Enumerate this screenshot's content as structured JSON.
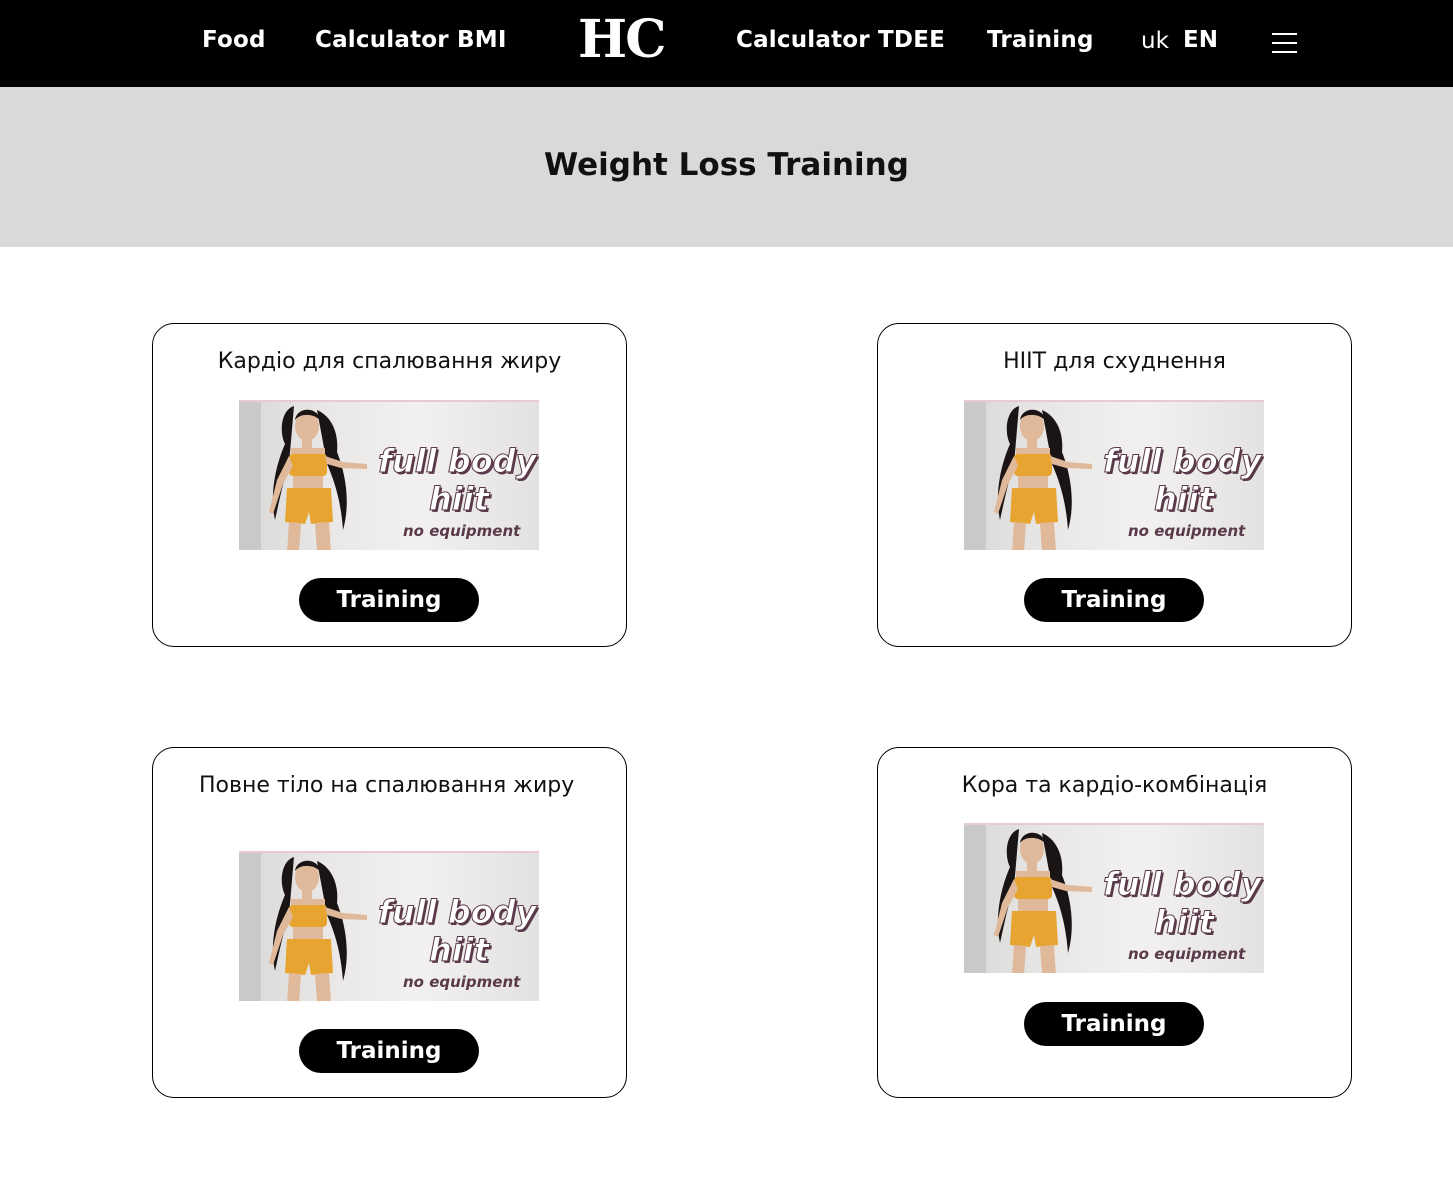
{
  "nav": {
    "food": "Food",
    "bmi": "Calculator BMI",
    "logo": "HC",
    "tdee": "Calculator TDEE",
    "training": "Training",
    "lang_uk": "uk",
    "lang_en": "EN"
  },
  "hero": {
    "title": "Weight Loss Training"
  },
  "cards": [
    {
      "title": "Кардіо для спалювання жиру",
      "thumb_line1": "full body",
      "thumb_line2": "hiit",
      "thumb_line3": "no equipment",
      "button": "Training"
    },
    {
      "title": "HIIT для схуднення",
      "thumb_line1": "full body",
      "thumb_line2": "hiit",
      "thumb_line3": "no equipment",
      "button": "Training"
    },
    {
      "title": "Повне тіло на спалювання жиру",
      "thumb_line1": "full body",
      "thumb_line2": "hiit",
      "thumb_line3": "no equipment",
      "button": "Training"
    },
    {
      "title": "Кора та кардіо-комбінація",
      "thumb_line1": "full body",
      "thumb_line2": "hiit",
      "thumb_line3": "no equipment",
      "button": "Training"
    }
  ],
  "colors": {
    "header_bg": "#000000",
    "hero_bg": "#d9d9d9",
    "outfit": "#e8a430",
    "thumb_text": "#ffffff",
    "thumb_shadow": "#5a3a4a"
  }
}
